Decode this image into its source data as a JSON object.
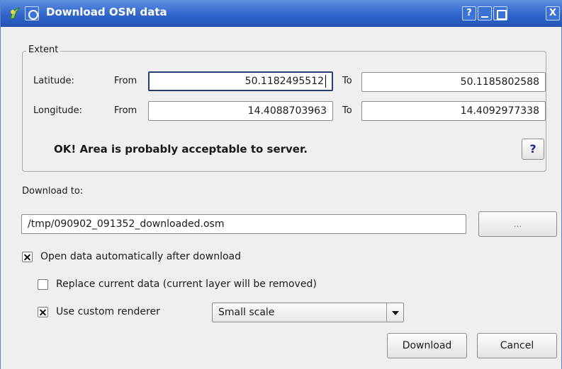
{
  "window": {
    "title": "Download OSM data",
    "help_label": "?",
    "close_label": "X"
  },
  "extent": {
    "legend": "Extent",
    "latitude_label": "Latitude:",
    "longitude_label": "Longitude:",
    "from_label": "From",
    "to_label": "To",
    "lat_from": "50.1182495512",
    "lat_to": "50.1185802588",
    "lon_from": "14.4088703963",
    "lon_to": "14.4092977338",
    "status": "OK! Area is probably acceptable to server.",
    "help_label": "?"
  },
  "download": {
    "label": "Download to:",
    "path": "/tmp/090902_091352_downloaded.osm",
    "browse_label": "...",
    "open_auto_label": "Open data automatically after download",
    "open_auto_checked": true,
    "replace_label": "Replace current data (current layer will be removed)",
    "replace_checked": false,
    "custom_renderer_label": "Use custom renderer",
    "custom_renderer_checked": true,
    "renderer_selected": "Small scale"
  },
  "buttons": {
    "download": "Download",
    "cancel": "Cancel"
  },
  "colors": {
    "titlebar": "#2e63c9",
    "window_bg": "#efefef",
    "focus_border": "#2a3d72"
  }
}
